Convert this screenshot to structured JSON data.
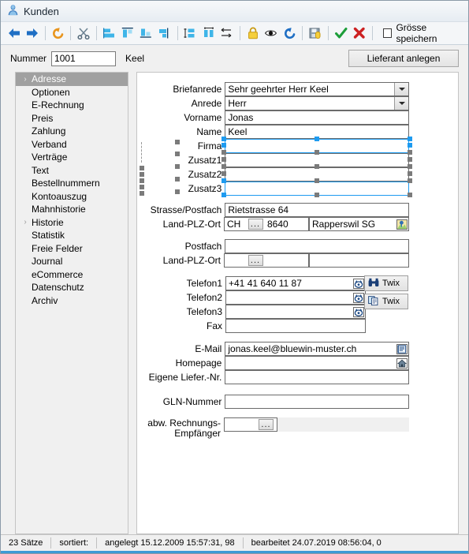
{
  "window": {
    "title": "Kunden",
    "icon": "user-icon"
  },
  "toolbar": {
    "buttons": [
      {
        "name": "back-arrow-icon",
        "label": "Zurück"
      },
      {
        "name": "forward-arrow-icon",
        "label": "Vorwärts"
      },
      {
        "name": "undo-icon",
        "label": "Rückgängig"
      },
      {
        "name": "cut-scissors-icon",
        "label": "Ausschneiden"
      },
      {
        "name": "align-left-icon",
        "label": "Links ausrichten"
      },
      {
        "name": "align-top-icon",
        "label": "Oben ausrichten"
      },
      {
        "name": "align-bottom-icon",
        "label": "Unten ausrichten"
      },
      {
        "name": "align-right-icon",
        "label": "Rechts ausrichten"
      },
      {
        "name": "spacing-vertical-icon",
        "label": "Vertikaler Abstand"
      },
      {
        "name": "spacing-horizontal-icon",
        "label": "Horizontaler Abstand"
      },
      {
        "name": "size-equal-icon",
        "label": "Gleiche Grösse"
      },
      {
        "name": "lock-icon",
        "label": "Sperren"
      },
      {
        "name": "eye-icon",
        "label": "Vorschau"
      },
      {
        "name": "refresh-icon",
        "label": "Aktualisieren"
      },
      {
        "name": "save-layout-icon",
        "label": "Layout speichern"
      },
      {
        "name": "confirm-check-icon",
        "label": "OK"
      },
      {
        "name": "cancel-cross-icon",
        "label": "Abbrechen"
      }
    ],
    "checkbox": {
      "label": "Grösse speichern",
      "checked": false
    }
  },
  "header": {
    "number_label": "Nummer",
    "number_value": "1001",
    "customer_name": "Keel",
    "create_supplier_button": "Lieferant anlegen"
  },
  "sidebar": {
    "items": [
      {
        "label": "Adresse",
        "expandable": true,
        "selected": true
      },
      {
        "label": "Optionen",
        "expandable": false,
        "selected": false
      },
      {
        "label": "E-Rechnung",
        "expandable": false,
        "selected": false
      },
      {
        "label": "Preis",
        "expandable": false,
        "selected": false
      },
      {
        "label": "Zahlung",
        "expandable": false,
        "selected": false
      },
      {
        "label": "Verband",
        "expandable": false,
        "selected": false
      },
      {
        "label": "Verträge",
        "expandable": false,
        "selected": false
      },
      {
        "label": "Text",
        "expandable": false,
        "selected": false
      },
      {
        "label": "Bestellnummern",
        "expandable": false,
        "selected": false
      },
      {
        "label": "Kontoauszug",
        "expandable": false,
        "selected": false
      },
      {
        "label": "Mahnhistorie",
        "expandable": false,
        "selected": false
      },
      {
        "label": "Historie",
        "expandable": true,
        "selected": false
      },
      {
        "label": "Statistik",
        "expandable": false,
        "selected": false
      },
      {
        "label": "Freie Felder",
        "expandable": false,
        "selected": false
      },
      {
        "label": "Journal",
        "expandable": false,
        "selected": false
      },
      {
        "label": "eCommerce",
        "expandable": false,
        "selected": false
      },
      {
        "label": "Datenschutz",
        "expandable": false,
        "selected": false
      },
      {
        "label": "Archiv",
        "expandable": false,
        "selected": false
      }
    ]
  },
  "form": {
    "briefanrede": {
      "label": "Briefanrede",
      "value": "Sehr geehrter Herr Keel"
    },
    "anrede": {
      "label": "Anrede",
      "value": "Herr"
    },
    "vorname": {
      "label": "Vorname",
      "value": "Jonas"
    },
    "name": {
      "label": "Name",
      "value": "Keel"
    },
    "firma": {
      "label": "Firma",
      "value": ""
    },
    "zusatz1": {
      "label": "Zusatz1",
      "value": ""
    },
    "zusatz2": {
      "label": "Zusatz2",
      "value": ""
    },
    "zusatz3": {
      "label": "Zusatz3",
      "value": ""
    },
    "strasse": {
      "label": "Strasse/Postfach",
      "value": "Rietstrasse 64"
    },
    "land_plz_ort": {
      "label": "Land-PLZ-Ort",
      "country": "CH",
      "plz": "8640",
      "ort": "Rapperswil SG",
      "browse_button": "...",
      "map_icon": "map-pin-icon"
    },
    "postfach": {
      "label": "Postfach",
      "value": ""
    },
    "postfach_land_plz_ort": {
      "label": "Land-PLZ-Ort",
      "country": "",
      "plz": "",
      "ort": "",
      "browse_button": "..."
    },
    "telefon1": {
      "label": "Telefon1",
      "value": "+41 41 640 11 87",
      "icon": "phone-dial-icon"
    },
    "telefon2": {
      "label": "Telefon2",
      "value": "",
      "icon": "phone-dial-icon"
    },
    "telefon3": {
      "label": "Telefon3",
      "value": "",
      "icon": "phone-dial-icon"
    },
    "fax": {
      "label": "Fax",
      "value": ""
    },
    "email": {
      "label": "E-Mail",
      "value": "jonas.keel@bluewin-muster.ch",
      "icon": "mail-card-icon"
    },
    "homepage": {
      "label": "Homepage",
      "value": "",
      "icon": "house-icon"
    },
    "eigene_liefer_nr": {
      "label": "Eigene Liefer.-Nr.",
      "value": ""
    },
    "gln_nummer": {
      "label": "GLN-Nummer",
      "value": ""
    },
    "abw_rechnungsempfaenger": {
      "label_line1": "abw. Rechnungs-",
      "label_line2": "Empfänger",
      "value": "",
      "browse_button": "..."
    },
    "twix_search": {
      "label": "Twix",
      "icon": "binoculars-icon"
    },
    "twix_copy": {
      "label": "Twix",
      "icon": "copy-icon"
    }
  },
  "statusbar": {
    "records": "23 Sätze",
    "sorted": "sortiert:",
    "created": "angelegt 15.12.2009 15:57:31, 98",
    "modified": "bearbeitet 24.07.2019 08:56:04,  0"
  },
  "colors": {
    "accent": "#1e9bf0",
    "selection_gray": "#a0a0a0",
    "bottom_bar": "#3c9ad6",
    "window_bg": "#f0f0f0"
  }
}
